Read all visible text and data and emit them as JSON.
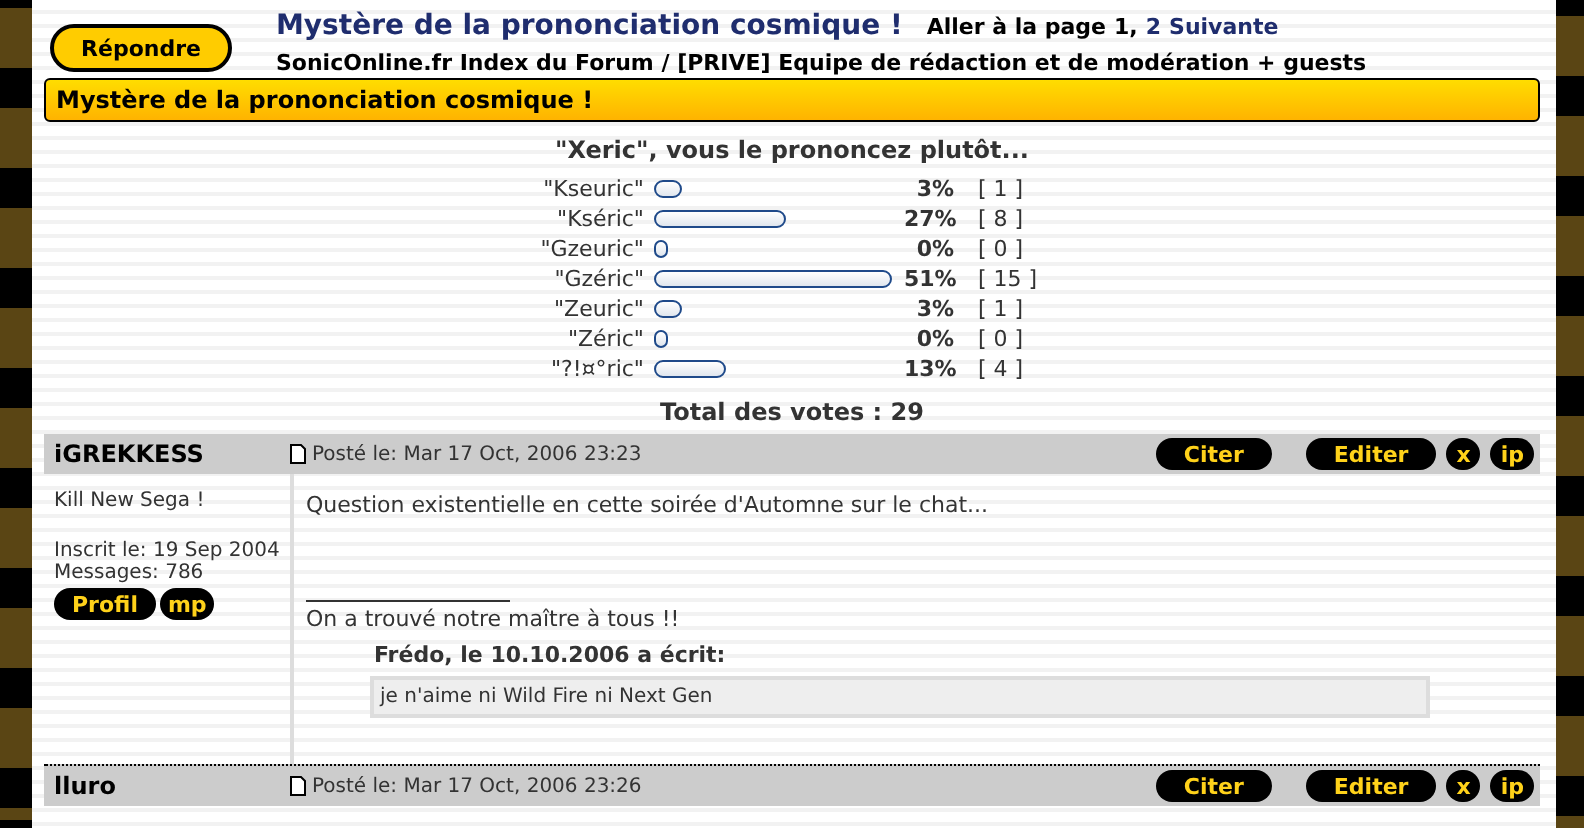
{
  "reply_button": "Répondre",
  "topic_title": "Mystère de la prononciation cosmique !",
  "pagination": {
    "prefix": "Aller à la page",
    "pages": [
      {
        "label": "1,",
        "selected": true
      },
      {
        "label": "2",
        "selected": false
      }
    ],
    "next": "Suivante"
  },
  "breadcrumb": "SonicOnline.fr Index du Forum / [PRIVE] Equipe de rédaction et de modération + guests",
  "banner": "Mystère de la prononciation cosmique !",
  "poll": {
    "question": "\"Xeric\", vous le prononcez plutôt...",
    "options": [
      {
        "label": "\"Kseuric\"",
        "percent": "3%",
        "count": "[ 1 ]"
      },
      {
        "label": "\"Kséric\"",
        "percent": "27%",
        "count": "[ 8 ]"
      },
      {
        "label": "\"Gzeuric\"",
        "percent": "0%",
        "count": "[ 0 ]"
      },
      {
        "label": "\"Gzéric\"",
        "percent": "51%",
        "count": "[ 15 ]"
      },
      {
        "label": "\"Zeuric\"",
        "percent": "3%",
        "count": "[ 1 ]"
      },
      {
        "label": "\"Zéric\"",
        "percent": "0%",
        "count": "[ 0 ]"
      },
      {
        "label": "\"?!¤°ric\"",
        "percent": "13%",
        "count": "[ 4 ]"
      }
    ],
    "total": "Total des votes : 29"
  },
  "posts": [
    {
      "author": "iGREKKESS",
      "posted": "Posté le: Mar 17 Oct, 2006 23:23",
      "actions": [
        "Citer",
        "Editer",
        "x",
        "ip"
      ],
      "user_title": "Kill New Sega !",
      "joined": "Inscrit le: 19 Sep 2004",
      "messages": "Messages: 786",
      "profile_buttons": [
        "Profil",
        "mp"
      ],
      "body": "Question existentielle en cette soirée d'Automne sur le chat...",
      "signature": "On a trouvé notre maître à tous !!",
      "quote": {
        "author": "Frédo, le 10.10.2006 a écrit:",
        "text": "je n'aime ni Wild Fire ni Next Gen"
      }
    },
    {
      "author": "lluro",
      "posted": "Posté le: Mar 17 Oct, 2006 23:26",
      "actions": [
        "Citer",
        "Editer",
        "x",
        "ip"
      ]
    }
  ]
}
